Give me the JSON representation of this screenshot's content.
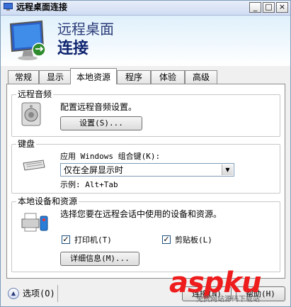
{
  "window": {
    "title": "远程桌面连接",
    "minimize_glyph": "_",
    "maximize_glyph": "□",
    "close_glyph": "×"
  },
  "header": {
    "line1": "远程桌面",
    "line2": "连接"
  },
  "tabs": [
    {
      "label": "常规"
    },
    {
      "label": "显示"
    },
    {
      "label": "本地资源"
    },
    {
      "label": "程序"
    },
    {
      "label": "体验"
    },
    {
      "label": "高级"
    }
  ],
  "audio": {
    "title": "远程音频",
    "description": "配置远程音频设置。",
    "button": "设置(S)..."
  },
  "keyboard": {
    "title": "键盘",
    "apply_label": "应用 Windows 组合键(K):",
    "selected": "仅在全屏显示时",
    "example": "示例: Alt+Tab"
  },
  "devices": {
    "title": "本地设备和资源",
    "description": "选择您要在远程会话中使用的设备和资源。",
    "printers_label": "打印机(T)",
    "printers_checked": true,
    "clipboard_label": "剪贴板(L)",
    "clipboard_checked": true,
    "details_button": "详细信息(M)..."
  },
  "footer": {
    "options_label": "选项(O)",
    "connect_button": "连接(N)",
    "help_button": "帮助(H)"
  },
  "watermark": {
    "text": "aspku",
    "sub": "免费网站源码下载站"
  }
}
